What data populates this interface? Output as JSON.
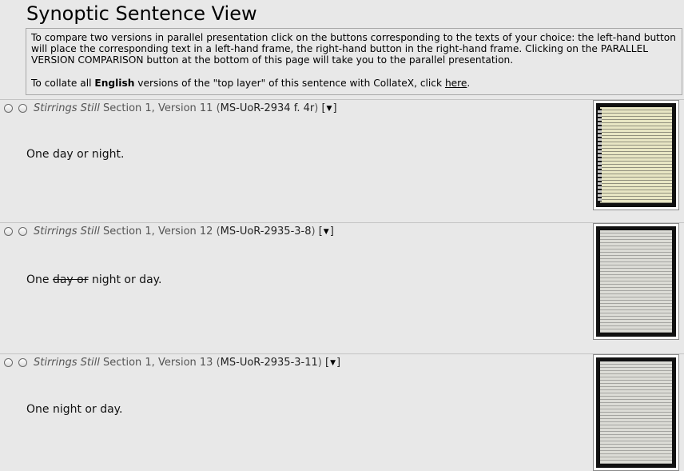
{
  "page": {
    "title": "Synoptic Sentence View"
  },
  "intro": {
    "p1": "To compare two versions in parallel presentation click on the buttons corresponding to the texts of your choice: the left-hand button will place the corresponding text in a left-hand frame, the right-hand button in the right-hand frame. Clicking on the PARALLEL VERSION COMPARISON button at the bottom of this page will take you to the parallel presentation.",
    "p2_before": "To collate all ",
    "p2_bold": "English",
    "p2_middle": " versions of the \"top layer\" of this sentence with CollateX, click ",
    "p2_link": "here",
    "p2_after": "."
  },
  "menu_icon": "dropdown-arrow-icon",
  "versions": [
    {
      "work": "Stirrings Still",
      "section": "Section 1, Version 11",
      "open_paren": "(",
      "manuscript": "MS-UoR-2934 f. 4r",
      "close_paren": ")",
      "bracket_open": "[",
      "arrow": "▼",
      "bracket_close": "]",
      "text": "One day or night."
    },
    {
      "work": "Stirrings Still",
      "section": "Section 1, Version 12",
      "open_paren": "(",
      "manuscript": "MS-UoR-2935-3-8",
      "close_paren": ")",
      "bracket_open": "[",
      "arrow": "▼",
      "bracket_close": "]",
      "text_prefix": "One ",
      "text_deleted": "day or",
      "text_suffix": " night or day."
    },
    {
      "work": "Stirrings Still",
      "section": "Section 1, Version 13",
      "open_paren": "(",
      "manuscript": "MS-UoR-2935-3-11",
      "close_paren": ")",
      "bracket_open": "[",
      "arrow": "▼",
      "bracket_close": "]",
      "text": "One night or day."
    }
  ]
}
